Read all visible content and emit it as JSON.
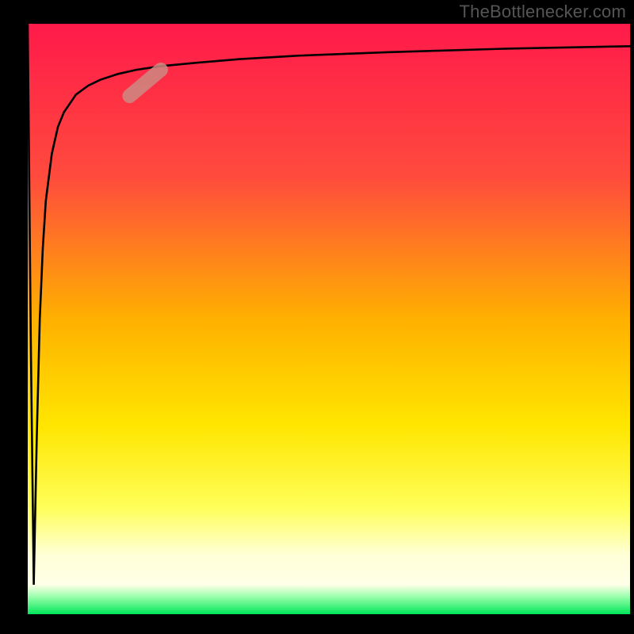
{
  "attribution": "TheBottlenecker.com",
  "colors": {
    "background_top": "#ff1a4a",
    "background_mid_upper": "#ff6b33",
    "background_mid": "#ffd200",
    "background_lower": "#ffff5a",
    "background_white_band": "#ffffd8",
    "background_bottom": "#00e65a",
    "frame": "#000000",
    "curve": "#000000",
    "marker": "#cc8a84"
  },
  "chart_data": {
    "type": "line",
    "title": "",
    "xlabel": "",
    "ylabel": "",
    "xlim": [
      0,
      100
    ],
    "ylim": [
      0,
      100
    ],
    "series": [
      {
        "name": "bottleneck_curve",
        "x": [
          0,
          0.5,
          1,
          1.5,
          2,
          2.5,
          3,
          4,
          5,
          6,
          8,
          10,
          12,
          15,
          18,
          22,
          28,
          35,
          45,
          60,
          80,
          100
        ],
        "y": [
          100,
          47,
          5,
          30,
          50,
          62,
          70,
          78,
          82.5,
          85,
          88,
          89.5,
          90.5,
          91.5,
          92.2,
          92.8,
          93.4,
          94,
          94.6,
          95.2,
          95.8,
          96.2
        ]
      }
    ],
    "marker": {
      "x_range": [
        16,
        23
      ],
      "y_range": [
        84,
        90
      ]
    },
    "background_gradient_stops": [
      {
        "pct": 0,
        "color": "#ff1a4a"
      },
      {
        "pct": 26,
        "color": "#ff4b3d"
      },
      {
        "pct": 50,
        "color": "#ffb000"
      },
      {
        "pct": 68,
        "color": "#ffe600"
      },
      {
        "pct": 82,
        "color": "#ffff5a"
      },
      {
        "pct": 90,
        "color": "#ffffd8"
      },
      {
        "pct": 95,
        "color": "#ffffe8"
      },
      {
        "pct": 97,
        "color": "#9cffad"
      },
      {
        "pct": 100,
        "color": "#00e65a"
      }
    ]
  }
}
